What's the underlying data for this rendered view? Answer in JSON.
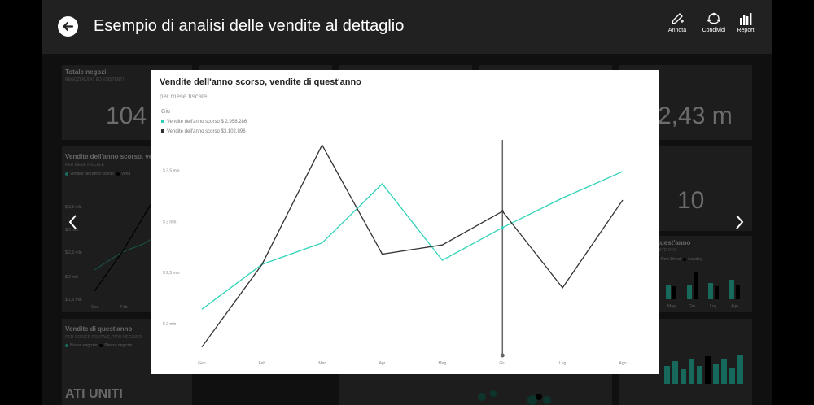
{
  "header": {
    "title": "Esempio di analisi delle vendite al dettaglio",
    "actions": [
      {
        "label": "Annota",
        "icon": "pen-icon"
      },
      {
        "label": "Condividi",
        "icon": "share-icon"
      },
      {
        "label": "Report",
        "icon": "bar-chart-icon"
      }
    ]
  },
  "background_tiles": {
    "tile1": {
      "title": "Totale negozi",
      "sub": "NEGOZI NUOVI ED ESISTENTI",
      "value": "104"
    },
    "tile2": {
      "value": "2,43 m"
    },
    "tile3": {
      "title": "Vendite dell'anno scorso, vend",
      "sub": "PER MESE FISCALE",
      "legend1": "Vendite dell'anno scorso",
      "legend2": "Vend",
      "yticks": [
        "$ 3,5 mln",
        "$ 3 mln",
        "$ 2,5 mln",
        "$ 2 mln",
        "$ 1,5 mln"
      ],
      "xticks": [
        "Gen",
        "Feb"
      ]
    },
    "tile4": {
      "value": "10"
    },
    "tile5": {
      "title": "quest'anno",
      "sub": "ESTERNO",
      "legend1": "New Direct",
      "legend2": "Lowdey",
      "xticks": [
        "Mag",
        "Giu",
        "Lug",
        "Ago"
      ]
    },
    "tile6": {
      "title": "Vendite di quest'anno",
      "sub": "PER CODICE POSTALE, TIPO NEGOZIO",
      "legend1": "Nuovo negozio",
      "legend2": "Stesso negozio",
      "map_label": "ATI UNITI"
    }
  },
  "modal": {
    "title": "Vendite dell'anno scorso, vendite di quest'anno",
    "subtitle": "per mese fiscale",
    "legend_title": "Giu",
    "legend": [
      {
        "label": "Vendite dell'anno scorso $ 2.958.286",
        "color": "#2ed3b7"
      },
      {
        "label": "Vendite dell'anno scorso $3.102.896",
        "color": "#333333"
      }
    ]
  },
  "chart_data": {
    "type": "line",
    "title": "Vendite dell'anno scorso, vendite di quest'anno",
    "subtitle": "per mese fiscale",
    "categories": [
      "Gen",
      "Feb",
      "Mar",
      "Apr",
      "Mag",
      "Giu",
      "Lug",
      "Ago"
    ],
    "ytick_labels": [
      "$ 3,5 mln",
      "$ 3 mln",
      "$ 2,5 mln",
      "$ 2 mln"
    ],
    "yticks": [
      3.5,
      3.0,
      2.5,
      2.0
    ],
    "ylim": [
      1.68,
      3.8
    ],
    "highlighted_category": "Giu",
    "series": [
      {
        "name": "Vendite dell'anno scorso $ 2.958.286",
        "color": "#2ed3b7",
        "values": [
          2.14,
          2.58,
          2.79,
          3.37,
          2.62,
          2.94,
          3.23,
          3.49
        ]
      },
      {
        "name": "Vendite dell'anno scorso $3.102.896",
        "color": "#333333",
        "values": [
          1.77,
          2.58,
          3.75,
          2.68,
          2.77,
          3.1,
          2.35,
          3.21
        ]
      }
    ]
  }
}
